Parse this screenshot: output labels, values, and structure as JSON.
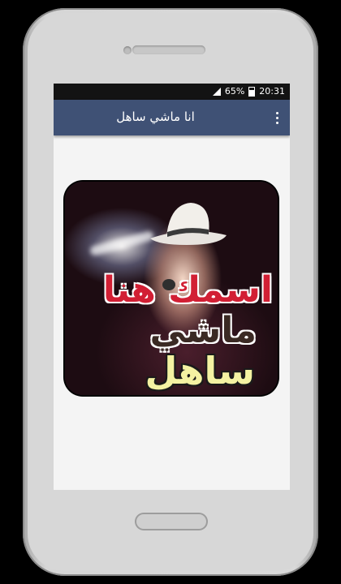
{
  "status_bar": {
    "battery": "65%",
    "time": "20:31"
  },
  "app_bar": {
    "title": "انا ماشي ساهل",
    "menu_icon": "overflow-menu-icon"
  },
  "card": {
    "overlay_text": [
      "اسمك هنا",
      "ماشي",
      "ساهل"
    ]
  },
  "colors": {
    "app_bar": "#3f5175",
    "status_bar": "#131313",
    "screen_background": "#f4f4f4"
  }
}
